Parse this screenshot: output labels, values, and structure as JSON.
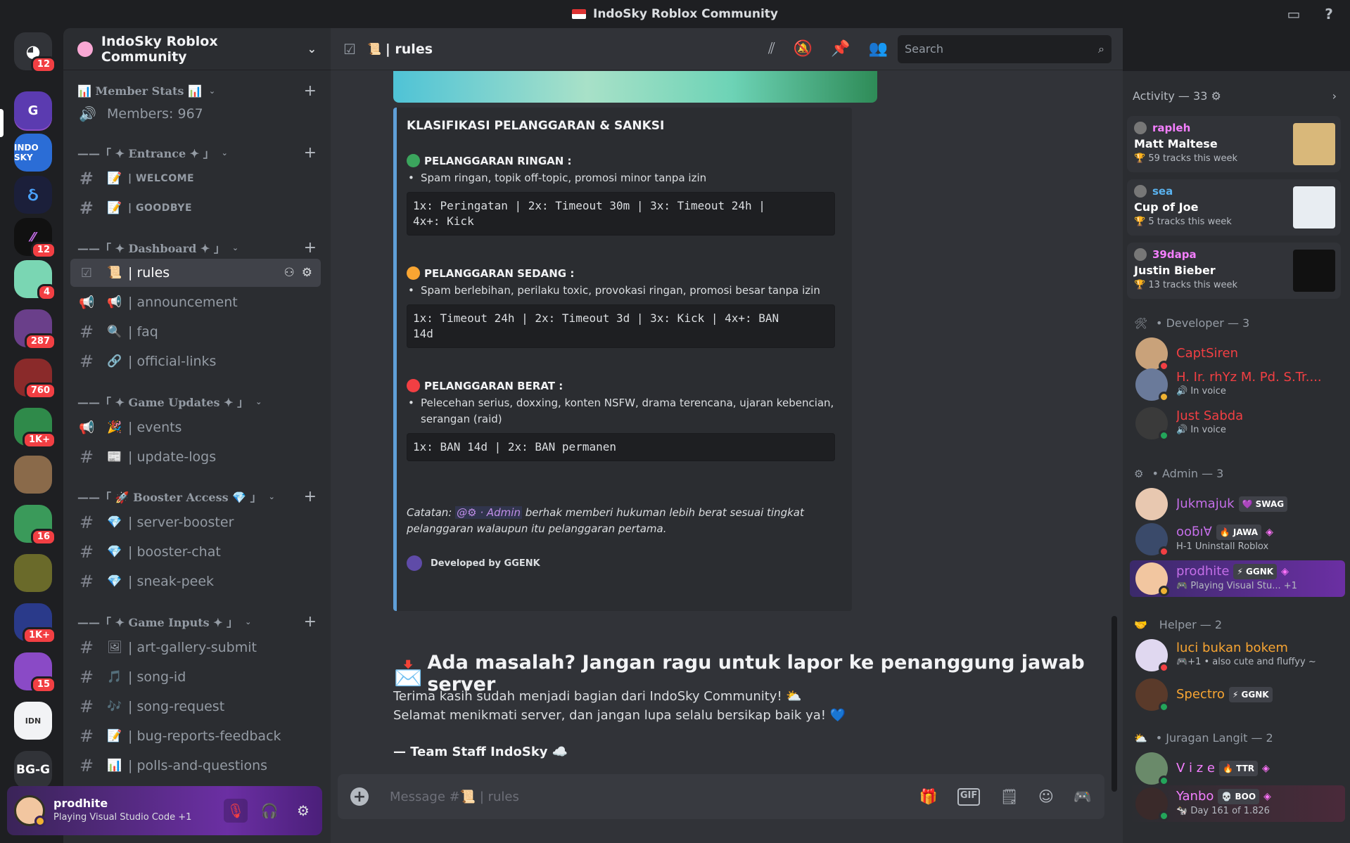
{
  "window": {
    "title": "IndoSky Roblox Community"
  },
  "colors": {
    "accent": "#5865f2",
    "mention": "#c08ee8",
    "embed_border": "#5f9fd8",
    "danger": "#f23f43",
    "online": "#23a55a",
    "idle": "#f0b232"
  },
  "servers": [
    {
      "name": "direct-messages",
      "badge": "12"
    },
    {
      "name": "server-2",
      "badge": ""
    },
    {
      "name": "indosky",
      "badge": ""
    },
    {
      "name": "server-4",
      "badge": ""
    },
    {
      "name": "server-5",
      "badge": "12"
    },
    {
      "name": "server-6",
      "badge": "4"
    },
    {
      "name": "server-7",
      "badge": "287"
    },
    {
      "name": "server-8",
      "badge": "760"
    },
    {
      "name": "server-9",
      "badge": "1K+"
    },
    {
      "name": "server-10",
      "badge": ""
    },
    {
      "name": "server-11",
      "badge": "16"
    },
    {
      "name": "server-12",
      "badge": ""
    },
    {
      "name": "server-13",
      "badge": "1K+"
    },
    {
      "name": "server-14",
      "badge": "15"
    },
    {
      "name": "server-15",
      "badge": ""
    },
    {
      "name": "server-16",
      "label": "BG-G",
      "badge": ""
    }
  ],
  "guild": {
    "name": "IndoSky Roblox Community"
  },
  "categories": [
    {
      "label": "📊 Member Stats 📊"
    },
    {
      "label": "——「 ✦ Entrance ✦ 」"
    },
    {
      "label": "——「 ✦ Dashboard ✦ 」"
    },
    {
      "label": "——「 ✦ Game Updates ✦ 」"
    },
    {
      "label": "——「 🚀 Booster Access 💎 」"
    },
    {
      "label": "——「 ✦ Game Inputs ✦ 」"
    }
  ],
  "channels": {
    "members": {
      "label": "Members: 967"
    },
    "welcome": {
      "emoji": "📝",
      "label": "| WELCOME"
    },
    "goodbye": {
      "emoji": "📝",
      "label": "| GOODBYE"
    },
    "rules": {
      "emoji": "📜",
      "label": "| rules"
    },
    "announcement": {
      "emoji": "📢",
      "label": "| announcement"
    },
    "faq": {
      "emoji": "🔍",
      "label": "| faq"
    },
    "official_links": {
      "emoji": "🔗",
      "label": "| official-links"
    },
    "events": {
      "emoji": "🎉",
      "label": "| events"
    },
    "update_logs": {
      "emoji": "📰",
      "label": "| update-logs"
    },
    "server_booster": {
      "emoji": "💎",
      "label": "| server-booster"
    },
    "booster_chat": {
      "emoji": "💎",
      "label": "| booster-chat"
    },
    "sneak_peek": {
      "emoji": "💎",
      "label": "| sneak-peek"
    },
    "art_gallery": {
      "emoji": "🖼",
      "label": "| art-gallery-submit"
    },
    "song_id": {
      "emoji": "🎵",
      "label": "| song-id"
    },
    "song_request": {
      "emoji": "🎶",
      "label": "| song-request"
    },
    "bug_reports": {
      "emoji": "📝",
      "label": "| bug-reports-feedback"
    },
    "polls": {
      "emoji": "📊",
      "label": "| polls-and-questions"
    }
  },
  "user": {
    "name": "prodhite",
    "status": "Playing Visual Studio Code +1"
  },
  "header": {
    "channel_emoji": "📜",
    "channel": "| rules",
    "search_placeholder": "Search"
  },
  "embed": {
    "title": "KLASIFIKASI PELANGGARAN & SANKSI",
    "sections": [
      {
        "color": "#3ba55d",
        "heading": "PELANGGARAN RINGAN :",
        "item": "Spam ringan, topik off-topic, promosi minor tanpa izin",
        "code1": "1x: Peringatan | 2x: Timeout 30m | 3x: Timeout 24h |",
        "code2": "4x+: Kick"
      },
      {
        "color": "#f8a532",
        "heading": "PELANGGARAN SEDANG :",
        "item": "Spam berlebihan, perilaku toxic, provokasi ringan, promosi besar tanpa izin",
        "code1": "1x: Timeout 24h | 2x: Timeout 3d | 3x: Kick | 4x+: BAN",
        "code2": "14d"
      },
      {
        "color": "#f23f43",
        "heading": "PELANGGARAN BERAT :",
        "item": "Pelecehan serius, doxxing, konten NSFW, drama terencana, ujaran kebencian,",
        "item2": "serangan (raid)",
        "code1": "1x: BAN 14d | 2x: BAN permanen",
        "code2": ""
      }
    ],
    "note_prefix": "Catatan: ",
    "note_mention": "@⚙ · Admin",
    "note_rest": " berhak memberi hukuman lebih berat sesuai tingkat",
    "note_line2": "pelanggaran walaupun itu pelanggaran pertama.",
    "footer": "Developed by GGENK"
  },
  "message": {
    "heading": "Ada masalah? Jangan ragu untuk lapor ke penanggung jawab server",
    "line1": "Terima kasih sudah menjadi bagian dari IndoSky Community! ⛅",
    "line2": "Selamat menikmati server, dan jangan lupa selalu bersikap baik ya! 💙",
    "signature": "— Team Staff IndoSky ☁️"
  },
  "composer": {
    "placeholder": "Message #📜 | rules"
  },
  "activity": {
    "header": "Activity — 33 ⚙",
    "items": [
      {
        "user": "rapleh",
        "user_color": "#f47fff",
        "title": "Matt Maltese",
        "sub": "🏆 59 tracks this week",
        "art": "#d9b87a"
      },
      {
        "user": "sea",
        "user_color": "#5ab3f0",
        "title": "Cup of Joe",
        "sub": "🏆 5 tracks this week",
        "art": "#e8edf2"
      },
      {
        "user": "39dapa",
        "user_color": "#f47fff",
        "title": "Justin Bieber",
        "sub": "🏆 13 tracks this week",
        "art": "#111111"
      }
    ]
  },
  "groups": {
    "developer": "Developer — 3",
    "admin": "Admin — 3",
    "helper": "Helper — 2",
    "juragan": "Juragan Langit — 2"
  },
  "members": [
    {
      "name": "CaptSiren",
      "color": "#f23f43",
      "sub": "",
      "tag": ""
    },
    {
      "name": "H. Ir. rhYz M. Pd. S.Tr....",
      "color": "#f23f43",
      "sub": "🔊 In voice",
      "tag": ""
    },
    {
      "name": "Just Sabda",
      "color": "#f23f43",
      "sub": "🔊 In voice",
      "tag": ""
    },
    {
      "name": "Jukmajuk",
      "color": "#c46ee8",
      "sub": "",
      "tag": "💜 SWAG"
    },
    {
      "name": "ooƃı∀",
      "color": "#c46ee8",
      "sub": "H-1 Uninstall Roblox",
      "tag": "🔥 JAWA"
    },
    {
      "name": "prodhite",
      "color": "#c46ee8",
      "sub": "🎮 Playing Visual Stu... +1",
      "tag": "⚡ GGNK"
    },
    {
      "name": "luci bukan bokem",
      "color": "#f8a532",
      "sub": "🎮+1 • also cute and fluffyy ~",
      "tag": ""
    },
    {
      "name": "Spectro",
      "color": "#f8a532",
      "sub": "",
      "tag": "⚡ GGNK"
    },
    {
      "name": "V i z e",
      "color": "#f47fff",
      "sub": "",
      "tag": "🔥 TTR"
    },
    {
      "name": "Yanbo",
      "color": "#f47fff",
      "sub": "🐄 Day 161 of 1.826",
      "tag": "💀 BOO"
    }
  ]
}
